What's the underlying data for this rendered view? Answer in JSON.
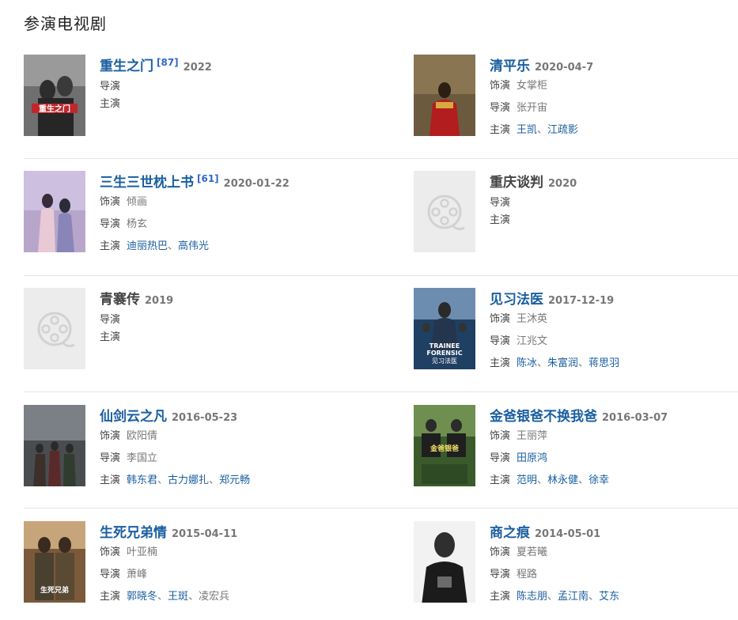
{
  "section_title": "参演电视剧",
  "icons": {
    "placeholder": "film-reel-icon"
  },
  "colors": {
    "link": "#1a5fa0",
    "divider": "#e6e6e6"
  },
  "labels": {
    "role": "饰演",
    "director": "导演",
    "cast": "主演"
  },
  "shows": [
    {
      "title": "重生之门",
      "score": "[87]",
      "date": "2022",
      "role": "",
      "director": "",
      "cast": []
    },
    {
      "title": "清平乐",
      "score": "",
      "date": "2020-04-7",
      "role": "女掌柜",
      "director": "张开宙",
      "cast": [
        "王凯",
        "江疏影"
      ]
    },
    {
      "title": "三生三世枕上书",
      "score": "[61]",
      "date": "2020-01-22",
      "role": "倾画",
      "director": "杨玄",
      "cast": [
        "迪丽热巴",
        "高伟光"
      ]
    },
    {
      "title": "重庆谈判",
      "score": "",
      "date": "2020",
      "role": "",
      "director": "",
      "cast": []
    },
    {
      "title": "青褰传",
      "score": "",
      "date": "2019",
      "role": "",
      "director": "",
      "cast": []
    },
    {
      "title": "见习法医",
      "score": "",
      "date": "2017-12-19",
      "role": "王沐英",
      "director": "江兆文",
      "cast": [
        "陈冰",
        "朱富润",
        "蒋思羽"
      ]
    },
    {
      "title": "仙剑云之凡",
      "score": "",
      "date": "2016-05-23",
      "role": "欧阳倩",
      "director": "李国立",
      "cast": [
        "韩东君",
        "古力娜扎",
        "郑元畅"
      ]
    },
    {
      "title": "金爸银爸不换我爸",
      "score": "",
      "date": "2016-03-07",
      "role": "王丽萍",
      "director": "田原鸿",
      "cast": [
        "范明",
        "林永健",
        "徐幸"
      ]
    },
    {
      "title": "生死兄弟情",
      "score": "",
      "date": "2015-04-11",
      "role": "叶亚楠",
      "director": "萧峰",
      "cast": [
        "郭晓冬",
        "王斑",
        "凌宏兵"
      ]
    },
    {
      "title": "商之痕",
      "score": "",
      "date": "2014-05-01",
      "role": "夏若曦",
      "director": "程路",
      "cast": [
        "陈志朋",
        "孟江南",
        "艾东"
      ]
    }
  ]
}
